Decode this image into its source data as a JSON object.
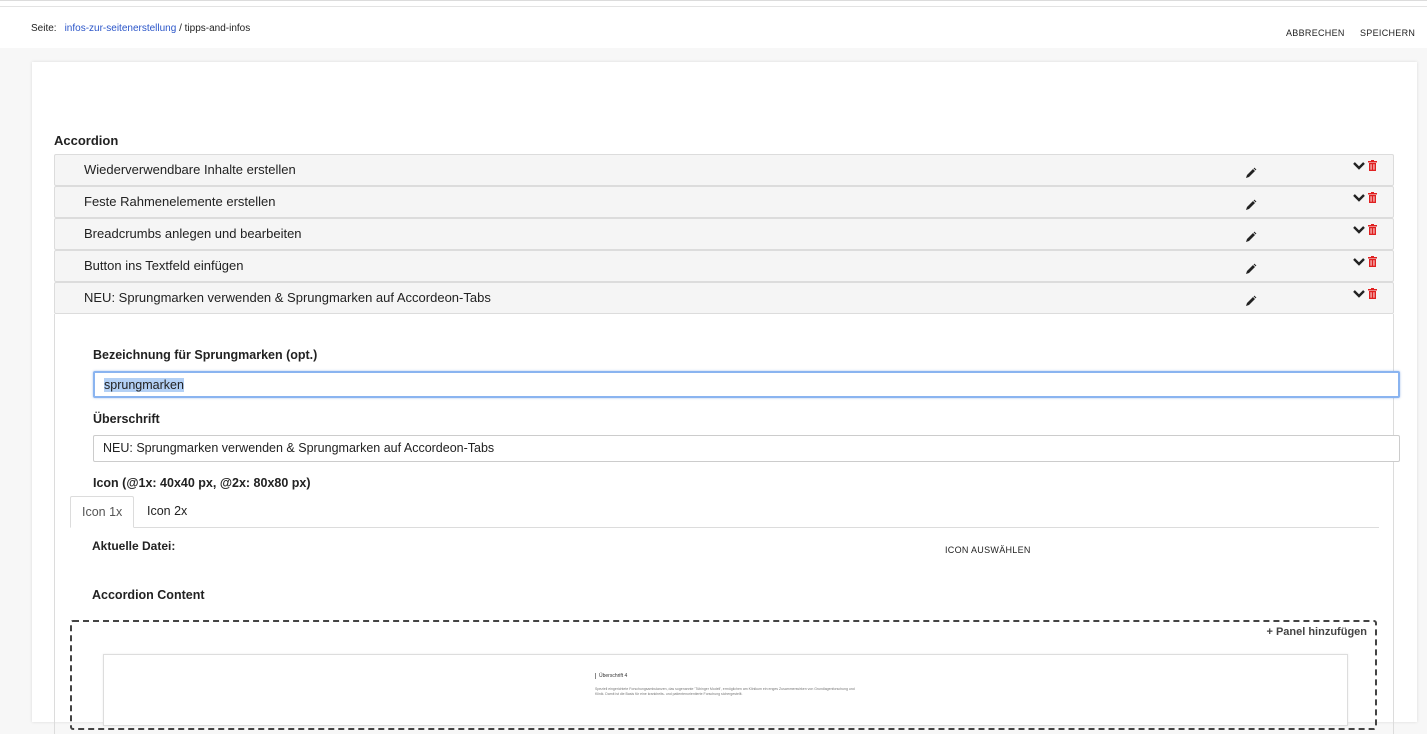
{
  "header": {
    "breadcrumb_label": "Seite:",
    "breadcrumb_link": "infos-zur-seitenerstellung",
    "breadcrumb_separator": " / ",
    "breadcrumb_current": "tipps-and-infos",
    "cancel_label": "ABBRECHEN",
    "save_label": "SPEICHERN"
  },
  "accordion": {
    "title": "Accordion",
    "items": [
      {
        "label": "Wiederverwendbare Inhalte erstellen"
      },
      {
        "label": "Feste Rahmenelemente erstellen"
      },
      {
        "label": "Breadcrumbs anlegen und bearbeiten"
      },
      {
        "label": "Button ins Textfeld einfügen"
      },
      {
        "label": "NEU: Sprungmarken verwenden & Sprungmarken auf Accordeon-Tabs"
      }
    ],
    "icons": {
      "edit": "pencil-icon",
      "toggle": "chevron-down-icon",
      "delete": "trash-icon"
    },
    "colors": {
      "delete": "#e02020"
    }
  },
  "form": {
    "anchor_label": "Bezeichnung für Sprungmarken (opt.)",
    "anchor_value": "sprungmarken",
    "heading_label": "Überschrift",
    "heading_value": "NEU: Sprungmarken verwenden & Sprungmarken auf Accordeon-Tabs",
    "icon_label": "Icon (@1x: 40x40 px, @2x: 80x80 px)",
    "tabs": [
      {
        "label": "Icon 1x"
      },
      {
        "label": "Icon 2x"
      }
    ],
    "current_file_label": "Aktuelle Datei:",
    "choose_icon_label": "ICON AUSWÄHLEN",
    "content_label": "Accordion Content",
    "add_panel_label": "Panel hinzufügen",
    "preview_heading": "Überschrift 4",
    "preview_text": "Speziell eingerichtete Forschungsambulanzen, das sogenannte 'Tübinger Modell', ermöglichen am Klinikum ein enges Zusammenwirken von Grundlagenforschung und Klinik. Damit ist die Basis für eine krankheits- und patientenorientierte Forschung sichergestellt."
  }
}
